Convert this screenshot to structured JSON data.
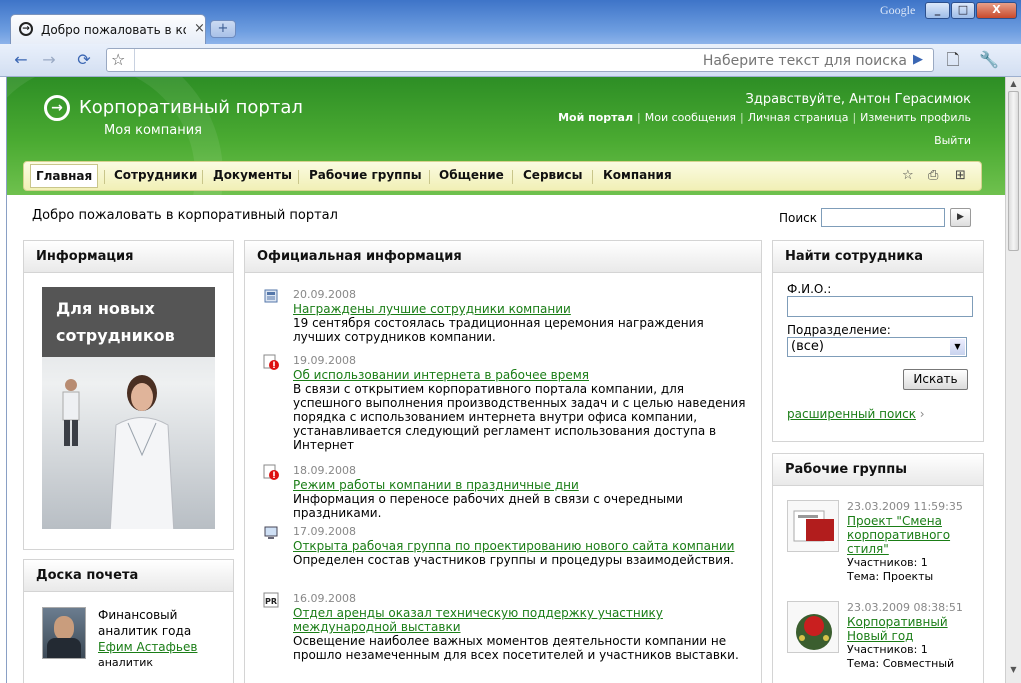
{
  "browser": {
    "tab_title": "Добро пожаловать в ко...",
    "tab_close": "×",
    "new_tab": "+",
    "brand": "Google",
    "win_min": "_",
    "win_max": "□",
    "win_close": "X",
    "search_placeholder": "Наберите текст для поиска"
  },
  "header": {
    "logo_title": "Корпоративный портал",
    "logo_subtitle": "Моя компания",
    "greeting": "Здравствуйте, Антон Герасимюк",
    "links": [
      "Мой портал",
      "Мои сообщения",
      "Личная страница",
      "Изменить профиль"
    ],
    "logout": "Выйти"
  },
  "menu": {
    "items": [
      "Главная",
      "Сотрудники",
      "Документы",
      "Рабочие группы",
      "Общение",
      "Сервисы",
      "Компания"
    ],
    "active": "Главная"
  },
  "welcome": "Добро пожаловать в корпоративный портал",
  "search": {
    "label": "Поиск",
    "value": ""
  },
  "info": {
    "title": "Информация",
    "banner_line1": "Для новых",
    "banner_line2": "сотрудников"
  },
  "honor": {
    "title": "Доска почета",
    "role": "Финансовый аналитик года",
    "role_line1": "Финансовый",
    "role_line2": "аналитик года",
    "name": "Ефим Астафьев",
    "position": "аналитик"
  },
  "official": {
    "title": "Официальная информация",
    "news": [
      {
        "icon": "news-icon",
        "date": "20.09.2008",
        "title": "Награждены лучшие сотрудники компании",
        "text": "19 сентября состоялась традиционная церемония награждения лучших сотрудников компании."
      },
      {
        "icon": "alert-icon",
        "date": "19.09.2008",
        "title": "Об использовании интернета в рабочее время",
        "text": "В связи с открытием корпоративного портала компании, для успешного выполнения производственных задач и с целью наведения порядка с использованием интернета внутри офиса компании, устанавливается следующий регламент использования доступа в Интернет"
      },
      {
        "icon": "alert-icon",
        "date": "18.09.2008",
        "title": "Режим работы компании в праздничные дни",
        "text": "Информация о переносе рабочих дней в связи с очередными праздниками."
      },
      {
        "icon": "computer-icon",
        "date": "17.09.2008",
        "title": "Открыта рабочая группа по проектированию нового сайта компании",
        "text": "Определен состав участников группы и процедуры взаимодействия."
      },
      {
        "icon": "pr-icon",
        "date": "16.09.2008",
        "title": "Отдел аренды оказал техническую поддержку участнику международной выставки",
        "text": "Освещение наиболее важных моментов деятельности компании не прошло незамеченным для всех посетителей и участников выставки."
      }
    ]
  },
  "find": {
    "title": "Найти сотрудника",
    "fio_label": "Ф.И.О.:",
    "dept_label": "Подразделение:",
    "dept_value": "(все)",
    "button": "Искать",
    "advanced": "расширенный поиск"
  },
  "groups": {
    "title": "Рабочие группы",
    "items": [
      {
        "date": "23.03.2009 11:59:35",
        "title": "Проект \"Смена корпоративного стиля\"",
        "members": "Участников: 1",
        "topic": "Тема: Проекты"
      },
      {
        "date": "23.03.2009 08:38:51",
        "title": "Корпоративный Новый год",
        "members": "Участников: 1",
        "topic": "Тема: Совместный"
      }
    ]
  }
}
